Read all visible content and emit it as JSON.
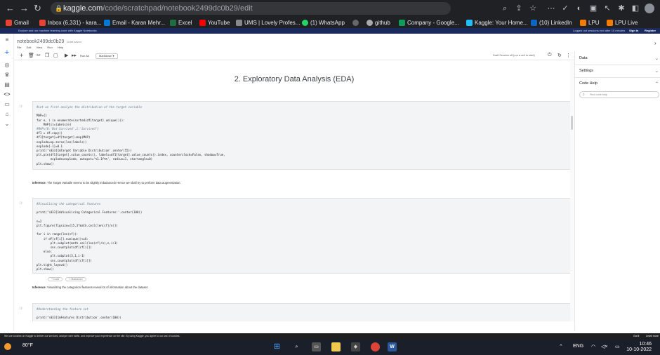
{
  "browser": {
    "url_host": "kaggle.com",
    "url_path": "/code/scratchpad/notebook2499dc0b29/edit",
    "bookmarks": [
      {
        "label": "Gmail",
        "color": "#ea4335"
      },
      {
        "label": "Inbox (6,331) - kara...",
        "color": "#ea4335"
      },
      {
        "label": "Email - Karan Mehr...",
        "color": "#0078d4"
      },
      {
        "label": "Excel",
        "color": "#1d6f42"
      },
      {
        "label": "YouTube",
        "color": "#ff0000"
      },
      {
        "label": "UMS | Lovely Profes...",
        "color": "#888888"
      },
      {
        "label": "(1) WhatsApp",
        "color": "#25d366"
      },
      {
        "label": "github",
        "color": "#aaaaaa"
      },
      {
        "label": "Company - Google...",
        "color": "#0f9d58"
      },
      {
        "label": "Kaggle: Your Home...",
        "color": "#20beff"
      },
      {
        "label": "(10) LinkedIn",
        "color": "#0a66c2"
      },
      {
        "label": "LPU",
        "color": "#f57c00"
      },
      {
        "label": "LPU Live",
        "color": "#f57c00"
      }
    ]
  },
  "kaggle_banner": {
    "left": "Explore and run machine learning code with Kaggle Notebooks.",
    "right": "Logged out sessions end after 15 minutes",
    "sign_in": "Sign In",
    "register": "Register"
  },
  "notebook": {
    "title": "notebook2499dc0b29",
    "draft": "Draft saved",
    "menu": [
      "File",
      "Edit",
      "View",
      "Run",
      "Help"
    ],
    "toolbar": {
      "run_all": "Run All",
      "cell_type": "Markdown",
      "session": "Draft Session off (run a cell to start)"
    },
    "section_title": "2. Exploratory Data Analysis (EDA)",
    "cells": [
      {
        "num": "[ ]:",
        "lines": [
          "#Let us first analyze the distribution of the target variable",
          "",
          "MAP={}",
          "for e, i in enumerate(sorted(df[target].unique())):",
          "    MAP[i]=labels[e]",
          "#MAP={0:'Not-Survived',1:'Survived'}",
          "df1 = df.copy()",
          "df1[target]=df[target].map(MAP)",
          "explode=np.zeros(len(labels))",
          "explode[-1]=0.1",
          "print('\\033[1mTarget Variable Distribution'.center(55))",
          "plt.pie(df1[target].value_counts(), labels=df1[target].value_counts().index, counterclock=False, shadow=True,",
          "        explode=explode, autopct='%1.1f%%', radius=1, startangle=0)",
          "plt.show()"
        ]
      },
      {
        "num": "[ ]:",
        "lines": [
          "#Visualising the categorical features",
          "",
          "print('\\033[1mVisualising Categorical Features:'.center(100))",
          "",
          "n=2",
          "plt.figure(figsize=[15,3*math.ceil(len(cf)/n)])",
          "",
          "for i in range(len(cf)):",
          "    if df[cf[i]].nunique()<=6:",
          "        plt.subplot(math.ceil(len(cf)/n),n,i+1)",
          "        sns.countplot(df[cf[i]])",
          "    else:",
          "        plt.subplot(3,1,i-1)",
          "        sns.countplot(df[cf[i]])",
          "plt.tight_layout()",
          "plt.show()"
        ]
      },
      {
        "num": "[ ]:",
        "lines": [
          "#Understanding the feature set",
          "",
          "print('\\033[1mFeatures Distribution'.center(100))"
        ]
      }
    ],
    "inference_1": {
      "label": "Inference:",
      "text": " The Target Variable seems to be slightly imbalanced! Hence we shall try to perform data augmentation."
    },
    "inference_2": {
      "label": "Inference:",
      "text": " Visualizing the categorical features reveal lot of information about the dataset."
    },
    "add_code": "+ Code",
    "add_markdown": "+ Markdown"
  },
  "right_panel": {
    "data": "Data",
    "settings": "Settings",
    "code_help": "Code Help",
    "search_placeholder": "Find code help"
  },
  "cookie_bar": {
    "text": "We use cookies on Kaggle to deliver our services, analyze web traffic, and improve your experience on the site. By using Kaggle, you agree to our use of cookies.",
    "ok": "Got it",
    "learn": "Learn more"
  },
  "taskbar": {
    "weather": "80°F",
    "lang": "ENG",
    "time": "10:46",
    "date": "10-10-2022"
  }
}
